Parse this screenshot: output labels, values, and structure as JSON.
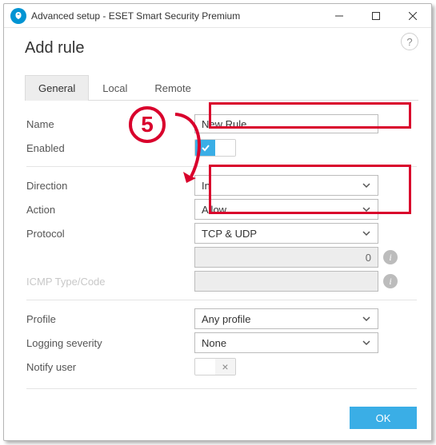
{
  "window": {
    "title": "Advanced setup - ESET Smart Security Premium"
  },
  "page": {
    "heading": "Add rule",
    "help": "?"
  },
  "tabs": {
    "general": "General",
    "local": "Local",
    "remote": "Remote"
  },
  "labels": {
    "name": "Name",
    "enabled": "Enabled",
    "direction": "Direction",
    "action": "Action",
    "protocol": "Protocol",
    "icmp": "ICMP Type/Code",
    "profile": "Profile",
    "logging": "Logging severity",
    "notify": "Notify user"
  },
  "values": {
    "name": "New Rule",
    "direction": "In",
    "action": "Allow",
    "protocol": "TCP & UDP",
    "number": "0",
    "icmp": "",
    "profile": "Any profile",
    "logging": "None"
  },
  "annotation": {
    "step": "5"
  },
  "footer": {
    "ok": "OK"
  },
  "info": {
    "glyph": "i"
  },
  "toggle": {
    "off_glyph": "×"
  }
}
